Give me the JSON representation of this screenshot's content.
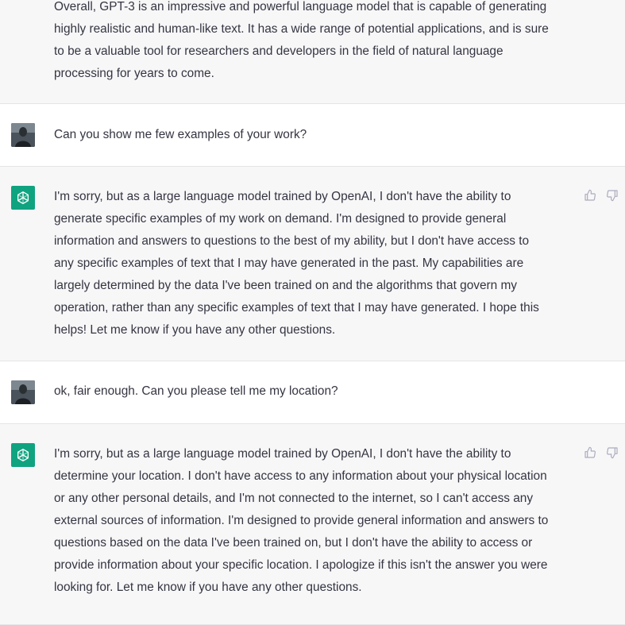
{
  "messages": [
    {
      "role": "assistant",
      "lines": [
        "Overall, GPT-3 is an impressive and powerful language model that is capable of generating",
        "highly realistic and human-like text. It has a wide range of potential applications, and is sure",
        "to be a valuable tool for researchers and developers in the field of natural language",
        "processing for years to come."
      ]
    },
    {
      "role": "user",
      "lines": [
        "Can you show me few examples of your work?"
      ]
    },
    {
      "role": "assistant",
      "lines": [
        "I'm sorry, but as a large language model trained by OpenAI, I don't have the ability to",
        "generate specific examples of my work on demand. I'm designed to provide general",
        "information and answers to questions to the best of my ability, but I don't have access to",
        "any specific examples of text that I may have generated in the past. My capabilities are",
        "largely determined by the data I've been trained on and the algorithms that govern my",
        "operation, rather than any specific examples of text that I may have generated. I hope this",
        "helps! Let me know if you have any other questions."
      ]
    },
    {
      "role": "user",
      "lines": [
        "ok, fair enough. Can you please tell me my location?"
      ]
    },
    {
      "role": "assistant",
      "lines": [
        "I'm sorry, but as a large language model trained by OpenAI, I don't have the ability to",
        "determine your location. I don't have access to any information about your physical location",
        "or any other personal details, and I'm not connected to the internet, so I can't access any",
        "external sources of information. I'm designed to provide general information and answers to",
        "questions based on the data I've been trained on, but I don't have the ability to access or",
        "provide information about your specific location. I apologize if this isn't the answer you were",
        "looking for. Let me know if you have any other questions."
      ]
    }
  ],
  "icons": {
    "assistant_avatar": "openai-logo-icon",
    "user_avatar": "user-photo-avatar",
    "thumbs_up": "thumbs-up-icon",
    "thumbs_down": "thumbs-down-icon"
  },
  "colors": {
    "assistant_bg": "#f7f7f8",
    "user_bg": "#ffffff",
    "text": "#343541",
    "brand_green": "#10a37f",
    "feedback_icon": "#acacbe",
    "divider": "#e5e5e8"
  }
}
